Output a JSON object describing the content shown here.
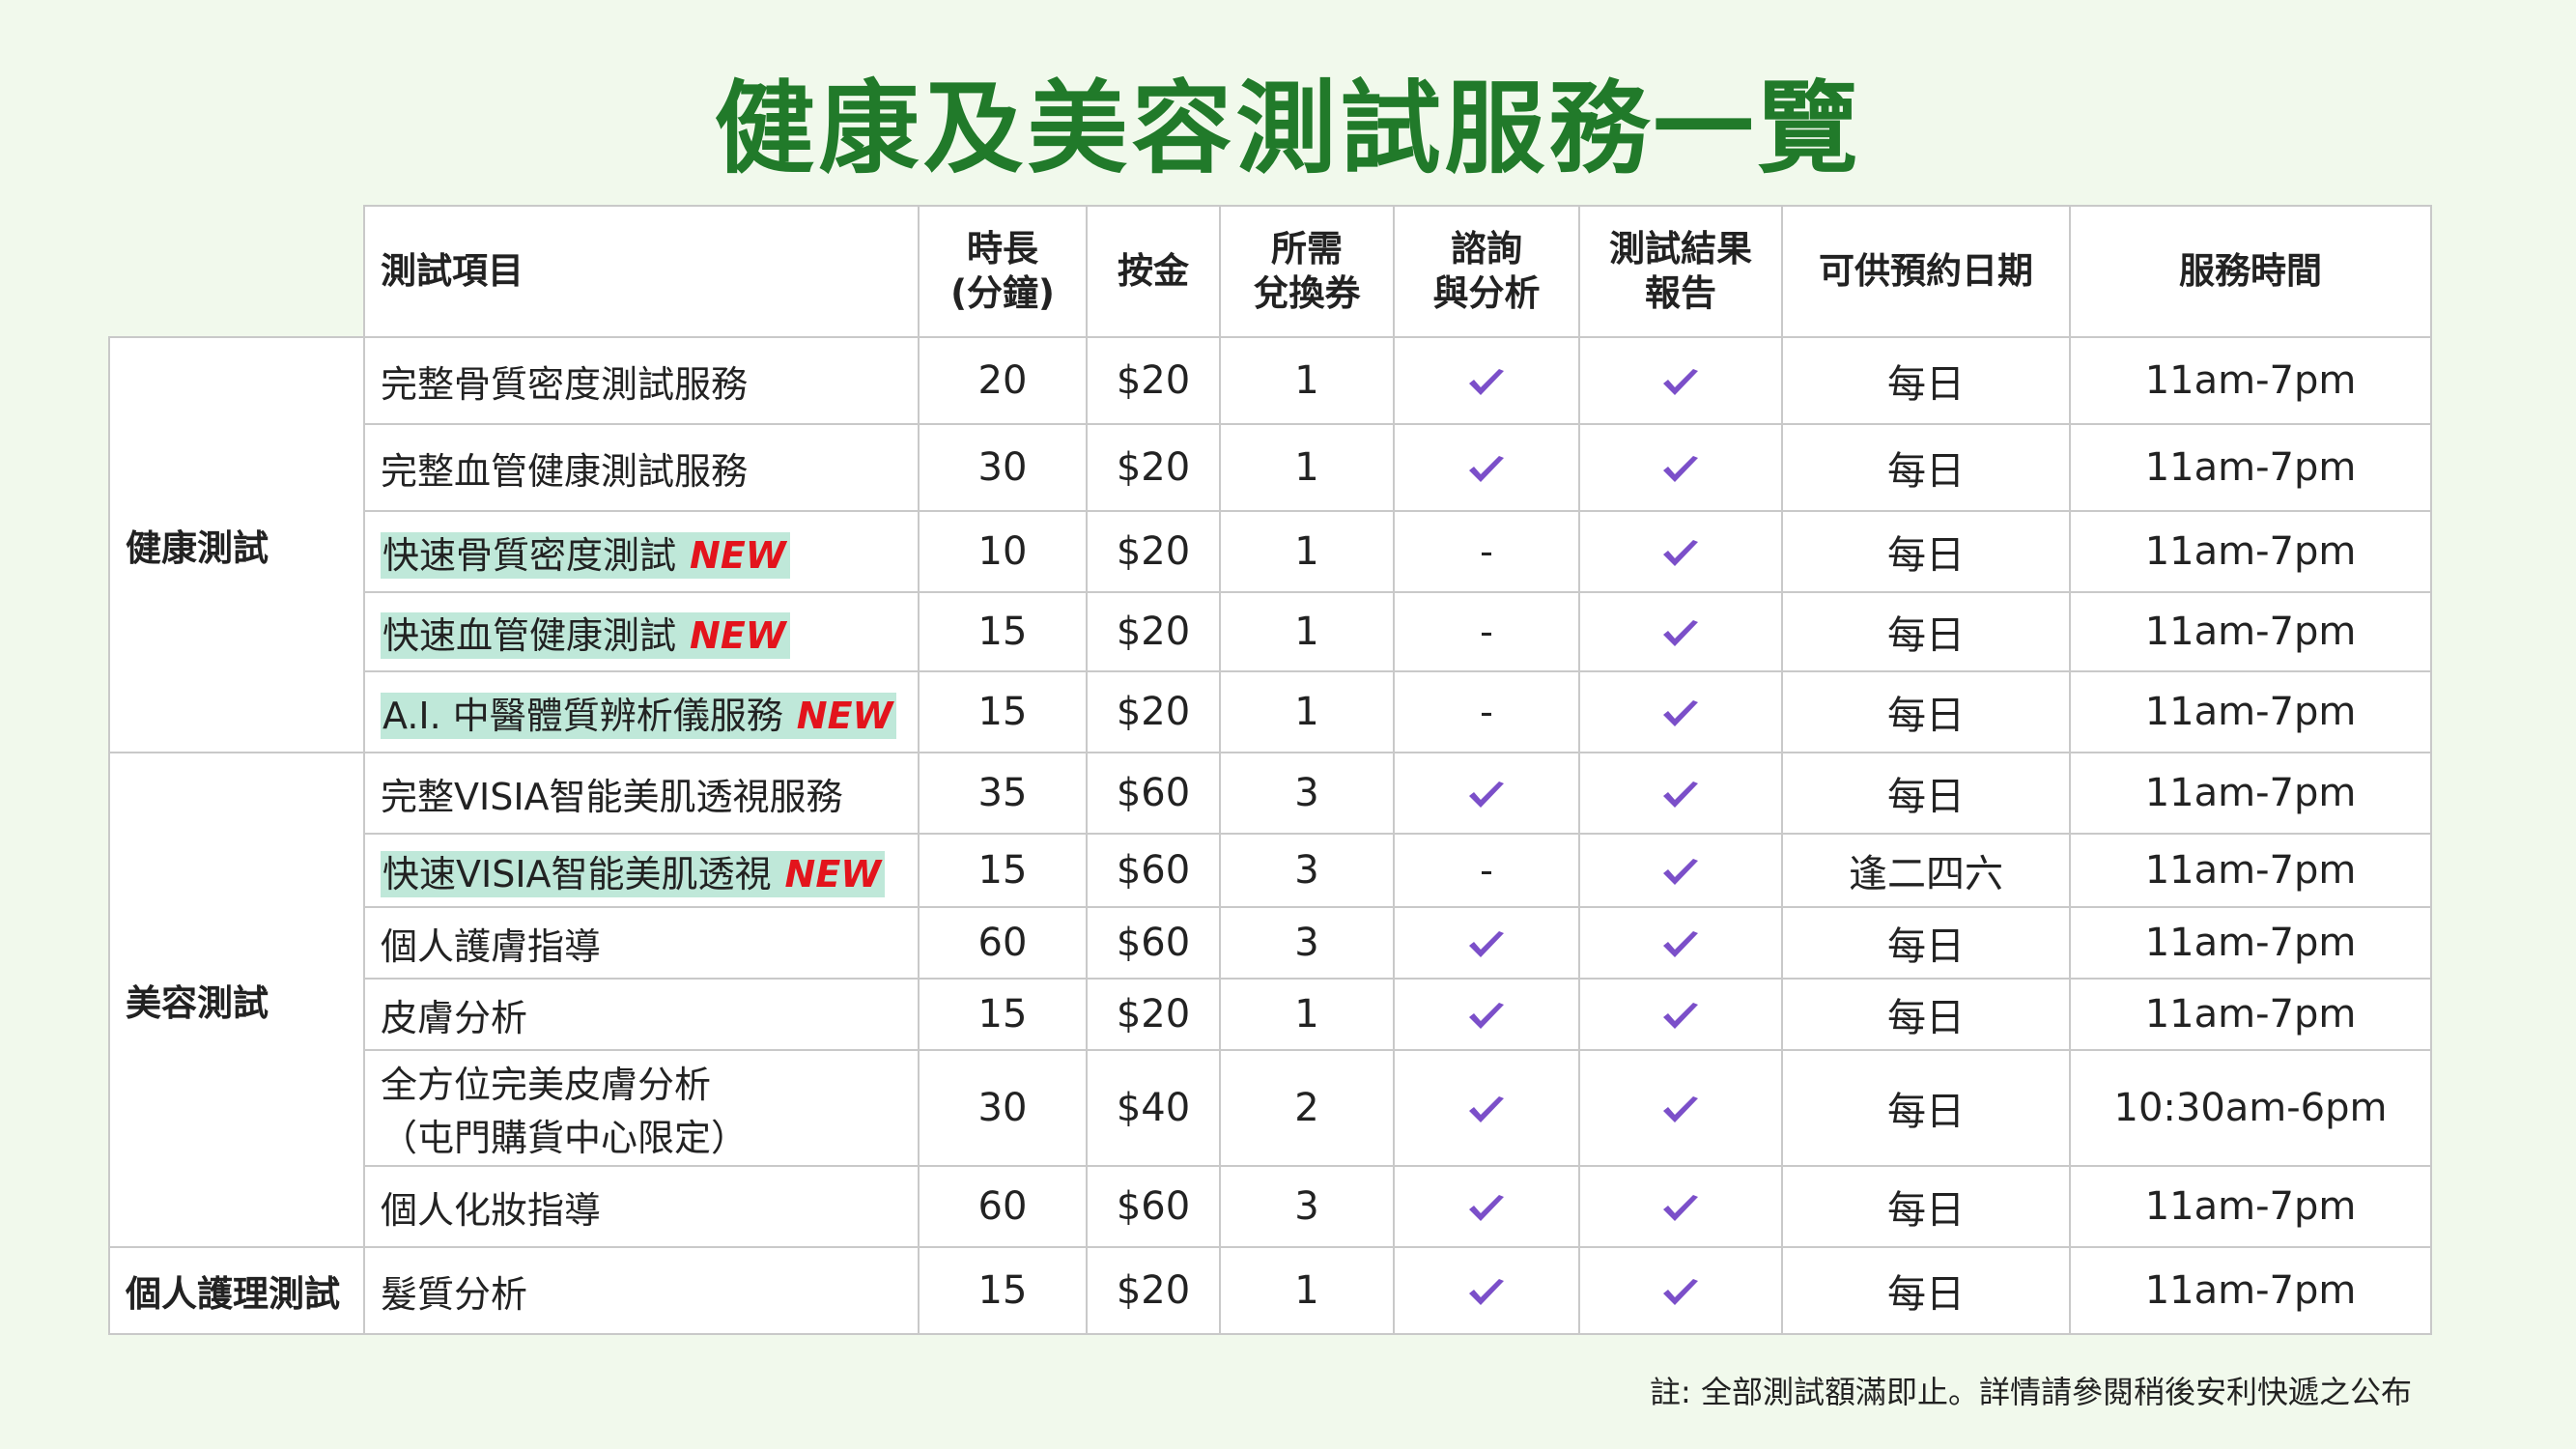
{
  "title": "健康及美容測試服務一覽",
  "headers": [
    "測試項目",
    "時長\n(分鐘)",
    "按金",
    "所需\n兌換券",
    "諮詢\n與分析",
    "測試結果\n報告",
    "可供預約日期",
    "服務時間"
  ],
  "categories": [
    "健康測試",
    "美容測試",
    "個人護理測試"
  ],
  "rows": [
    {
      "item": "完整骨質密度測試服務",
      "is_new": false,
      "duration": "20",
      "deposit": "$20",
      "vouchers": "1",
      "consult": true,
      "report": true,
      "dates": "每日",
      "hours": "11am-7pm"
    },
    {
      "item": "完整血管健康測試服務",
      "is_new": false,
      "duration": "30",
      "deposit": "$20",
      "vouchers": "1",
      "consult": true,
      "report": true,
      "dates": "每日",
      "hours": "11am-7pm"
    },
    {
      "item": "快速骨質密度測試",
      "is_new": true,
      "duration": "10",
      "deposit": "$20",
      "vouchers": "1",
      "consult": false,
      "report": true,
      "dates": "每日",
      "hours": "11am-7pm"
    },
    {
      "item": "快速血管健康測試",
      "is_new": true,
      "duration": "15",
      "deposit": "$20",
      "vouchers": "1",
      "consult": false,
      "report": true,
      "dates": "每日",
      "hours": "11am-7pm"
    },
    {
      "item": "A.I. 中醫體質辨析儀服務",
      "is_new": true,
      "duration": "15",
      "deposit": "$20",
      "vouchers": "1",
      "consult": false,
      "report": true,
      "dates": "每日",
      "hours": "11am-7pm"
    },
    {
      "item": "完整VISIA智能美肌透視服務",
      "is_new": false,
      "duration": "35",
      "deposit": "$60",
      "vouchers": "3",
      "consult": true,
      "report": true,
      "dates": "每日",
      "hours": "11am-7pm"
    },
    {
      "item": "快速VISIA智能美肌透視",
      "is_new": true,
      "duration": "15",
      "deposit": "$60",
      "vouchers": "3",
      "consult": false,
      "report": true,
      "dates": "逢二四六",
      "hours": "11am-7pm"
    },
    {
      "item": "個人護膚指導",
      "is_new": false,
      "duration": "60",
      "deposit": "$60",
      "vouchers": "3",
      "consult": true,
      "report": true,
      "dates": "每日",
      "hours": "11am-7pm"
    },
    {
      "item": "皮膚分析",
      "is_new": false,
      "duration": "15",
      "deposit": "$20",
      "vouchers": "1",
      "consult": true,
      "report": true,
      "dates": "每日",
      "hours": "11am-7pm"
    },
    {
      "item": "全方位完美皮膚分析",
      "item_sub": "（屯門購貨中心限定）",
      "is_new": false,
      "duration": "30",
      "deposit": "$40",
      "vouchers": "2",
      "consult": true,
      "report": true,
      "dates": "每日",
      "hours": "10:30am-6pm"
    },
    {
      "item": "個人化妝指導",
      "is_new": false,
      "duration": "60",
      "deposit": "$60",
      "vouchers": "3",
      "consult": true,
      "report": true,
      "dates": "每日",
      "hours": "11am-7pm"
    },
    {
      "item": "髮質分析",
      "is_new": false,
      "duration": "15",
      "deposit": "$20",
      "vouchers": "1",
      "consult": true,
      "report": true,
      "dates": "每日",
      "hours": "11am-7pm"
    }
  ],
  "new_label": "NEW",
  "dash_label": "-",
  "note": "註: 全部測試額滿即止。詳情請參閱稍後安利快遞之公布",
  "colors": {
    "title": "#217a2a",
    "check": "#7b4fc9",
    "new": "#e3141c",
    "highlight": "#bfe8d9",
    "background": "#f1f9ec"
  },
  "icons": {
    "check": "check-icon"
  }
}
